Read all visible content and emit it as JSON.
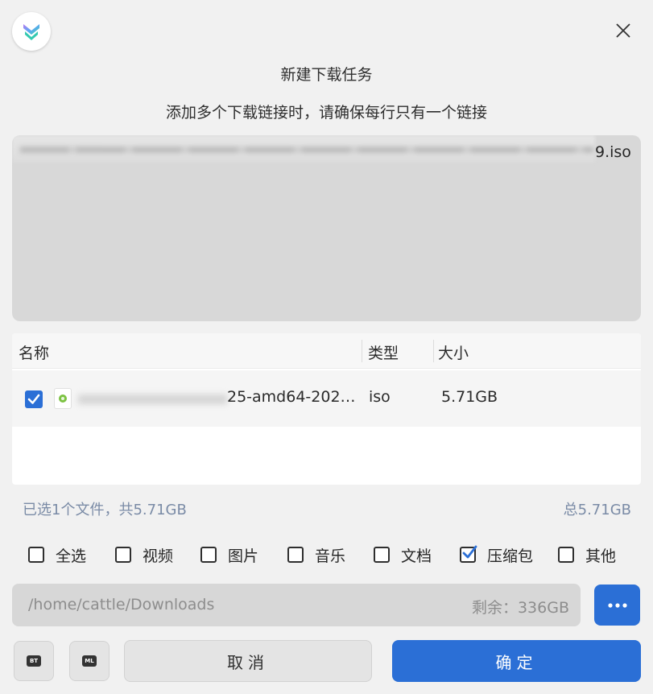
{
  "dialog": {
    "title": "新建下载任务",
    "subtitle": "添加多个下载链接时，请确保每行只有一个链接"
  },
  "url_input": {
    "visible_tail": "9.iso"
  },
  "table": {
    "headers": {
      "name": "名称",
      "type": "类型",
      "size": "大小"
    },
    "rows": [
      {
        "checked": true,
        "name_visible": "25-amd64-202…",
        "type": "iso",
        "size": "5.71GB"
      }
    ]
  },
  "summary": {
    "selected": "已选1个文件，共5.71GB",
    "total": "总5.71GB"
  },
  "filters": [
    {
      "label": "全选",
      "checked": false
    },
    {
      "label": "视频",
      "checked": false
    },
    {
      "label": "图片",
      "checked": false
    },
    {
      "label": "音乐",
      "checked": false
    },
    {
      "label": "文档",
      "checked": false
    },
    {
      "label": "压缩包",
      "checked": true
    },
    {
      "label": "其他",
      "checked": false
    }
  ],
  "path": {
    "value": "/home/cattle/Downloads",
    "free_space": "剩余：336GB"
  },
  "buttons": {
    "bt_badge": "BT",
    "ml_badge": "ML",
    "cancel": "取消",
    "ok": "确定"
  },
  "colors": {
    "accent": "#2b6fd6",
    "summary_text": "#7a8ba6"
  }
}
